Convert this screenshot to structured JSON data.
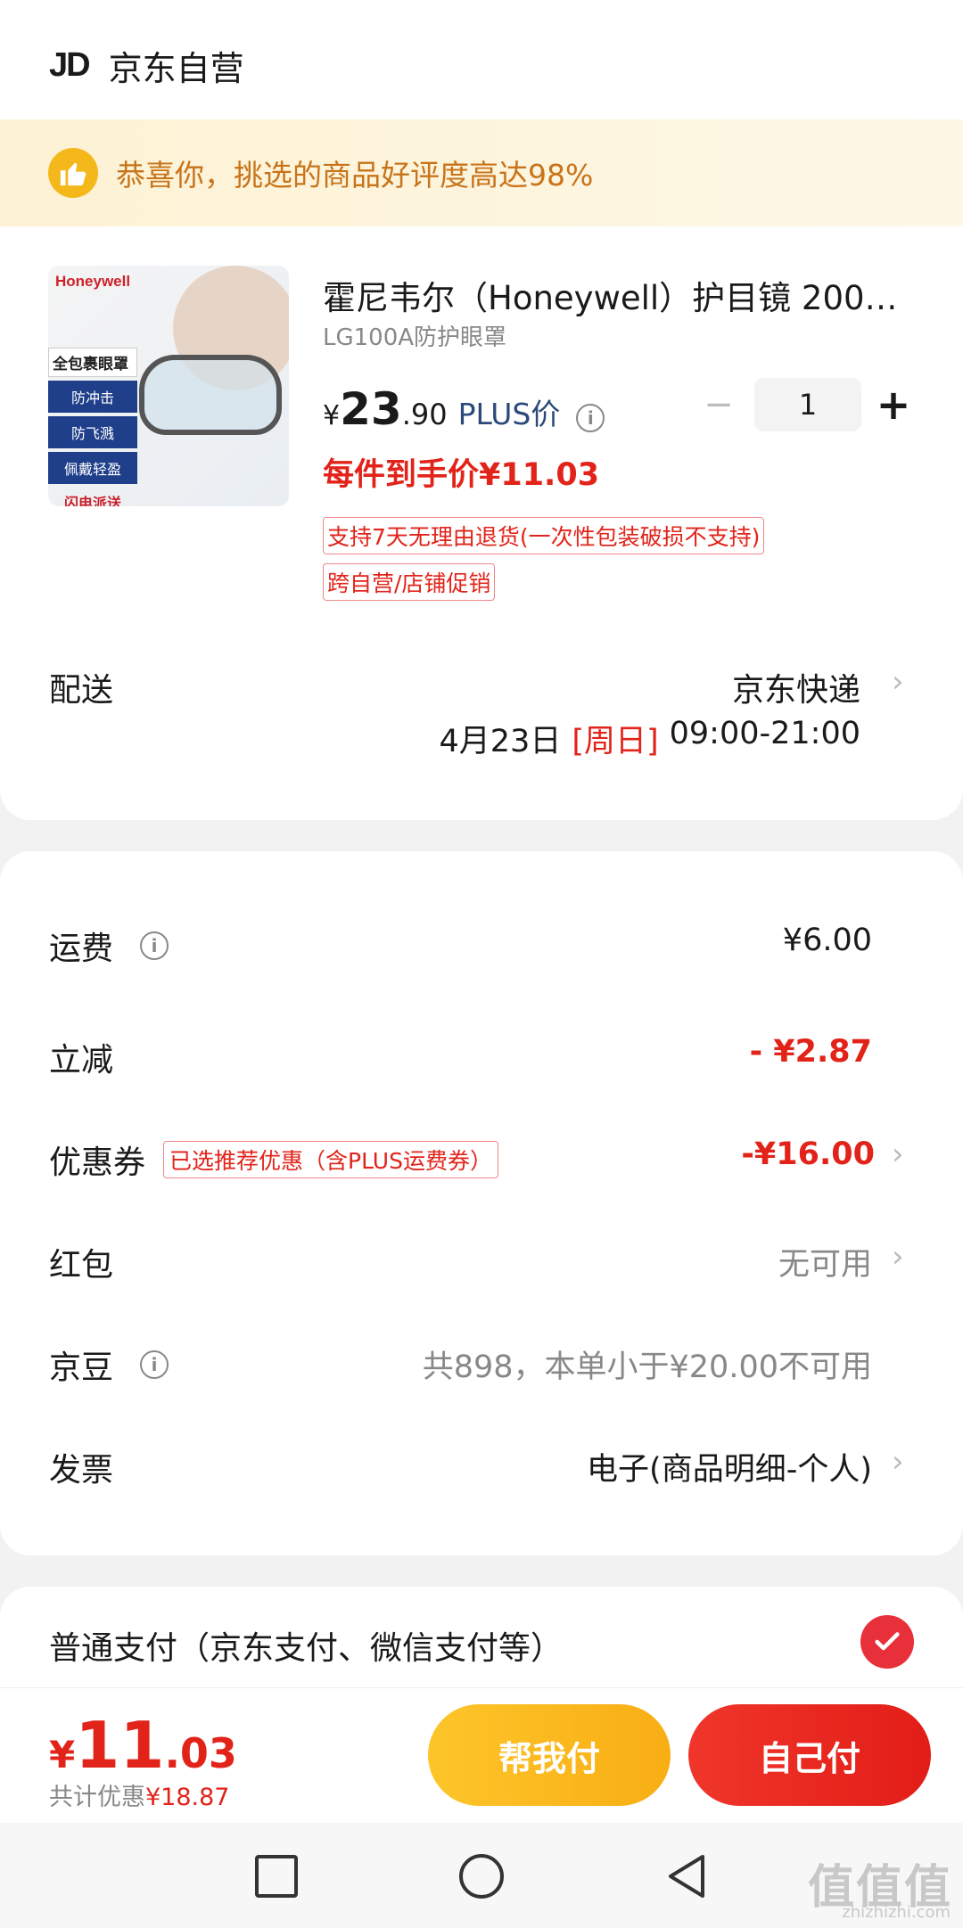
{
  "store": {
    "logo": "JD",
    "name": "京东自营"
  },
  "banner": {
    "text": "恭喜你，挑选的商品好评度高达98%",
    "icon": "thumbs-up-icon"
  },
  "product": {
    "image": {
      "brand": "Honeywell",
      "tag_head": "全包裹眼罩",
      "tags": [
        "防冲击",
        "防飞溅",
        "佩戴轻盈"
      ],
      "tag_foot": "闪电派送"
    },
    "title": "霍尼韦尔（Honeywell）护目镜 200…",
    "spec": "LG100A防护眼罩",
    "price_symbol": "¥",
    "price_int": "23",
    "price_dec": ".90",
    "plus_label": "PLUS价",
    "quantity": "1",
    "final_price": "每件到手价¥11.03",
    "service_tags": [
      "支持7天无理由退货(一次性包装破损不支持)",
      "跨自营/店铺促销"
    ]
  },
  "delivery": {
    "label": "配送",
    "method": "京东快递",
    "date": "4月23日",
    "weekday": "[周日]",
    "time": "09:00-21:00"
  },
  "fees": {
    "shipping": {
      "label": "运费",
      "value": "¥6.00"
    },
    "discount": {
      "label": "立减",
      "value": "- ¥2.87"
    },
    "coupon": {
      "label": "优惠券",
      "tag": "已选推荐优惠（含PLUS运费券）",
      "value": "-¥16.00"
    },
    "redpacket": {
      "label": "红包",
      "value": "无可用"
    },
    "jingdou": {
      "label": "京豆",
      "value": "共898，本单小于¥20.00不可用"
    },
    "invoice": {
      "label": "发票",
      "value": "电子(商品明细-个人)"
    }
  },
  "payment": {
    "label": "普通支付（京东支付、微信支付等）"
  },
  "bottom": {
    "symbol": "¥",
    "int": "11",
    "dec": ".03",
    "saved_label": "共计优惠",
    "saved_value": "¥18.87",
    "help_pay": "帮我付",
    "self_pay": "自己付"
  },
  "watermark": {
    "main": "值值值",
    "sub": "zhizhizhi.com"
  },
  "colors": {
    "accent_red": "#e2231a",
    "banner_text": "#c8741a",
    "plus_blue": "#2b4a79",
    "help_yellow": "#f8ae14"
  }
}
